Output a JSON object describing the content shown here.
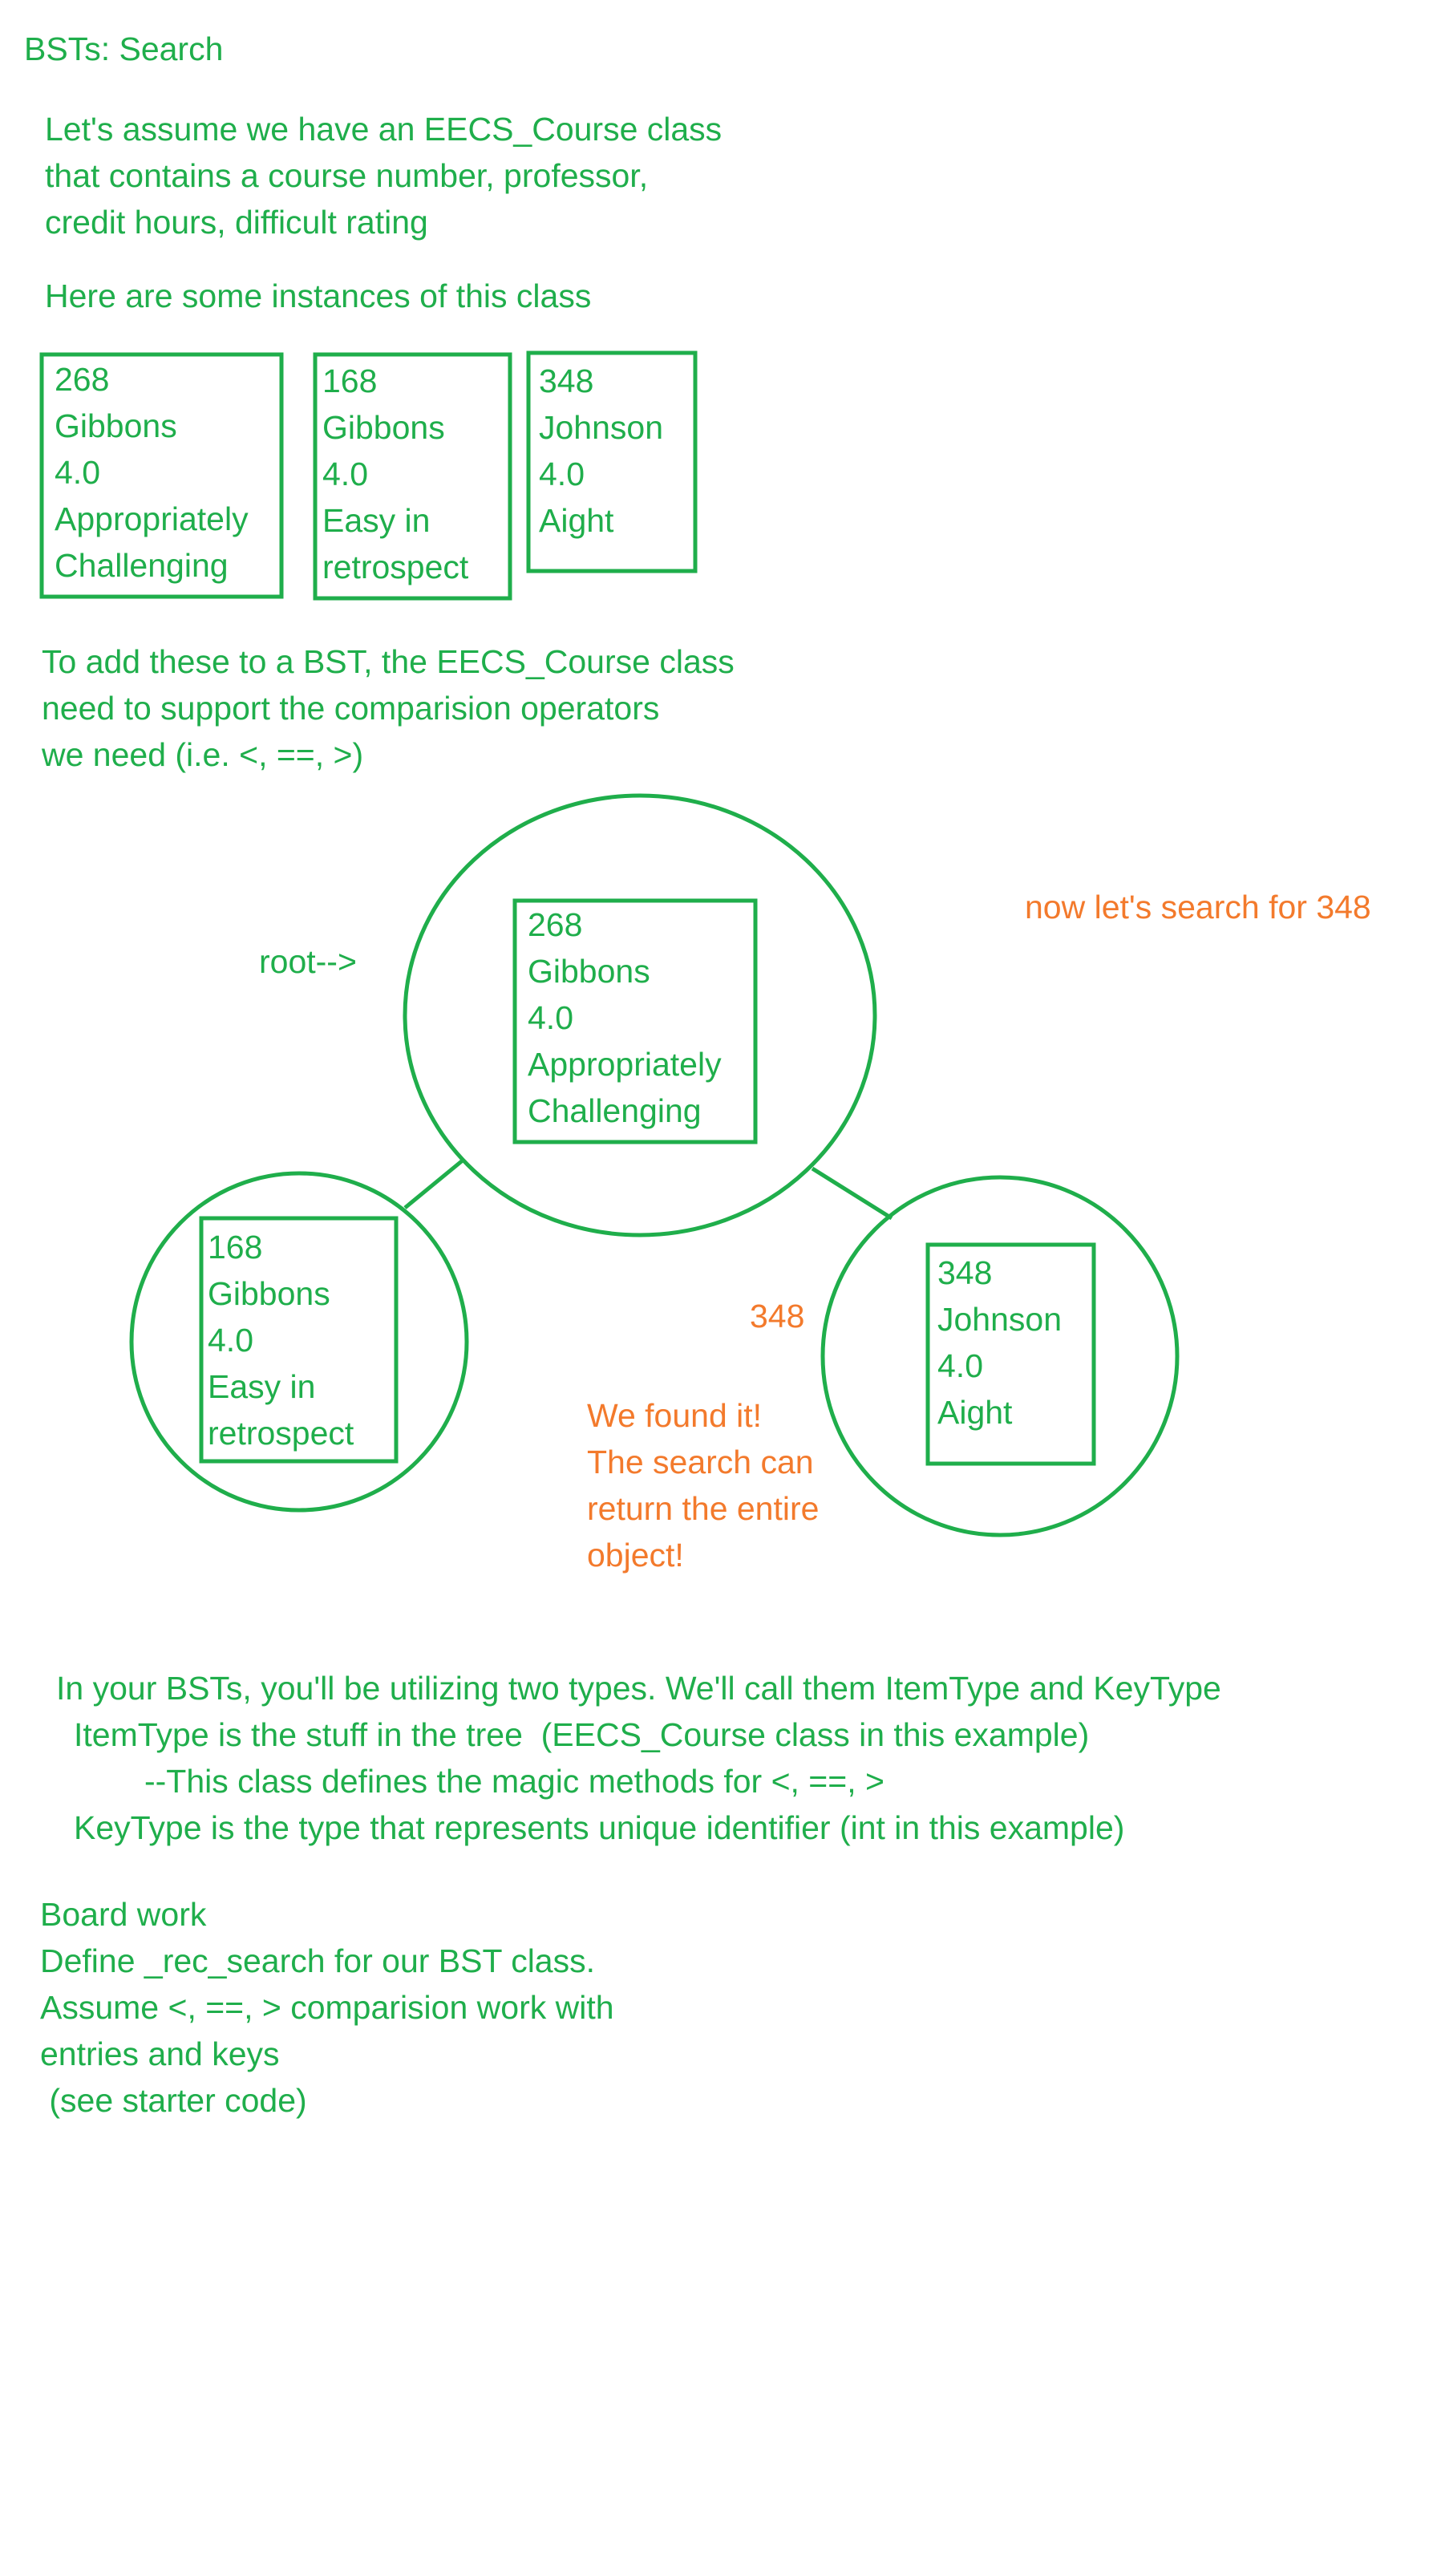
{
  "title": "BSTs: Search",
  "intro": {
    "line1": "Let's assume we have an EECS_Course class",
    "line2": "that contains a course number, professor,",
    "line3": "credit hours, difficult rating",
    "instances_heading": "Here are some instances of this class"
  },
  "instances": [
    {
      "number": "268",
      "professor": "Gibbons",
      "credits": "4.0",
      "rating_line1": "Appropriately",
      "rating_line2": "Challenging"
    },
    {
      "number": "168",
      "professor": "Gibbons",
      "credits": "4.0",
      "rating_line1": "Easy in",
      "rating_line2": "retrospect"
    },
    {
      "number": "348",
      "professor": "Johnson",
      "credits": "4.0",
      "rating_line1": "Aight",
      "rating_line2": ""
    }
  ],
  "add_note": {
    "line1": "To add these to a BST, the EECS_Course class",
    "line2": "need to support the comparision operators",
    "line3": "we need (i.e. <, ==, >)"
  },
  "tree": {
    "root_label": "root-->",
    "search_note": "now let's search for 348",
    "search_key": "348",
    "root": {
      "number": "268",
      "professor": "Gibbons",
      "credits": "4.0",
      "rating_line1": "Appropriately",
      "rating_line2": "Challenging"
    },
    "left": {
      "number": "168",
      "professor": "Gibbons",
      "credits": "4.0",
      "rating_line1": "Easy in",
      "rating_line2": "retrospect"
    },
    "right": {
      "number": "348",
      "professor": "Johnson",
      "credits": "4.0",
      "rating_line1": "Aight"
    },
    "found_note": {
      "line1": "We found it!",
      "line2": "The search can",
      "line3": "return the entire",
      "line4": "object!"
    }
  },
  "types_note": {
    "line1": "In your BSTs, you'll be utilizing two types. We'll call them ItemType and KeyType",
    "line2": "ItemType is the stuff in the tree  (EECS_Course class in this example)",
    "line3": "--This class defines the magic methods for <, ==, >",
    "line4": "KeyType is the type that represents unique identifier (int in this example)"
  },
  "board_work": {
    "line1": "Board work",
    "line2": "Define _rec_search for our BST class.",
    "line3": "Assume <, ==, > comparision work with",
    "line4": "entries and keys",
    "line5": " (see starter code)"
  },
  "colors": {
    "ink_green": "#1fae4b",
    "ink_orange": "#f37a2c",
    "background": "#ffffff"
  }
}
